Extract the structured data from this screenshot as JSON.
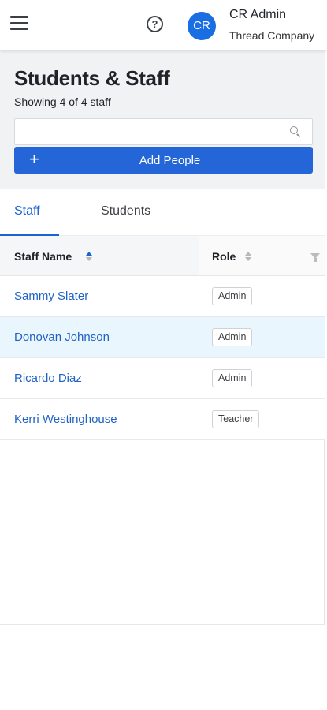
{
  "header": {
    "avatar_initials": "CR",
    "user_name": "CR Admin",
    "company": "Thread Company",
    "icons": {
      "menu": "hamburger-icon",
      "help": "help-circle-icon"
    },
    "help_glyph": "?"
  },
  "page": {
    "title": "Students & Staff",
    "count_text": "Showing 4 of 4 staff",
    "search": {
      "value": "",
      "placeholder": ""
    },
    "add_button": {
      "plus": "+",
      "label": "Add People"
    }
  },
  "tabs": [
    {
      "label": "Staff",
      "active": true
    },
    {
      "label": "Students",
      "active": false
    }
  ],
  "table": {
    "columns": [
      "Staff Name",
      "Role"
    ],
    "sorted_column": "Staff Name",
    "rows": [
      {
        "name": "Sammy Slater",
        "role": "Admin"
      },
      {
        "name": "Donovan Johnson",
        "role": "Admin"
      },
      {
        "name": "Ricardo Diaz",
        "role": "Admin"
      },
      {
        "name": "Kerri Westinghouse",
        "role": "Teacher"
      }
    ],
    "highlighted_row": 1
  },
  "colors": {
    "primary": "#2466d8",
    "link": "#1f62c6",
    "row_highlight": "#eaf6fd",
    "panel_bg": "#f1f2f4"
  }
}
